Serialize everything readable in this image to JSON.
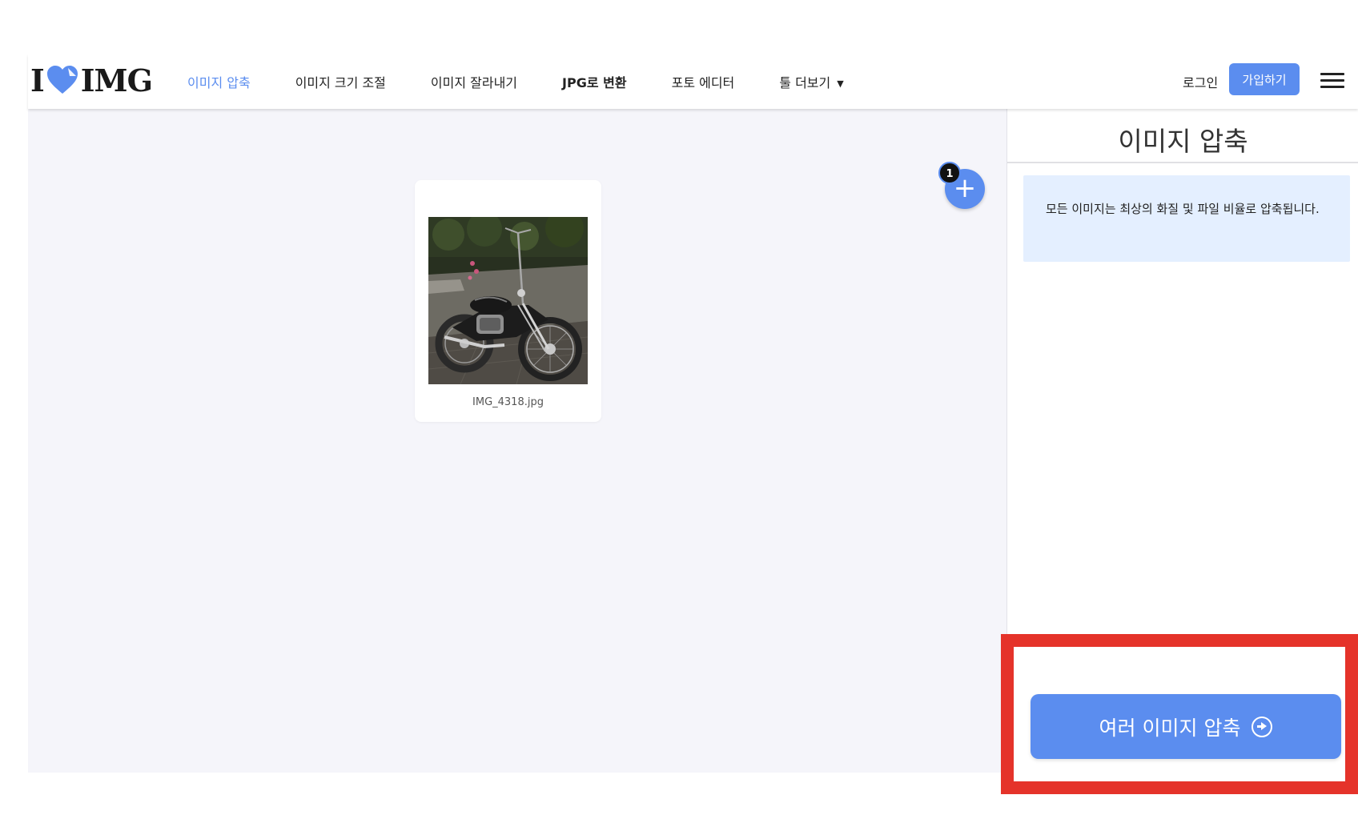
{
  "logo": {
    "left": "I",
    "right": "IMG",
    "heart_color": "#5b8def"
  },
  "nav": {
    "items": [
      {
        "label": "이미지 압축",
        "active": true
      },
      {
        "label": "이미지 크기 조절",
        "active": false
      },
      {
        "label": "이미지 잘라내기",
        "active": false
      },
      {
        "label": "JPG로 변환",
        "active": false
      },
      {
        "label": "포토 에디터",
        "active": false
      },
      {
        "label": "툴 더보기",
        "active": false
      }
    ],
    "more_icon": "caret-down-icon"
  },
  "header": {
    "login_label": "로그인",
    "signup_label": "가입하기",
    "menu_icon": "hamburger-menu-icon"
  },
  "workspace": {
    "file": {
      "name": "IMG_4318.jpg",
      "thumbnail": "motorcycle photo"
    },
    "add_button_icon": "plus-icon",
    "file_count": "1"
  },
  "panel": {
    "title": "이미지 압축",
    "info_text": "모든 이미지는 최상의 화질 및 파일 비율로 압축됩니다.",
    "action_label": "여러 이미지 압축",
    "action_icon": "arrow-right-circle-icon"
  },
  "colors": {
    "accent": "#5b8def",
    "highlight": "#e5332a",
    "workspace_bg": "#f5f5fa",
    "info_bg": "#e4efff"
  }
}
